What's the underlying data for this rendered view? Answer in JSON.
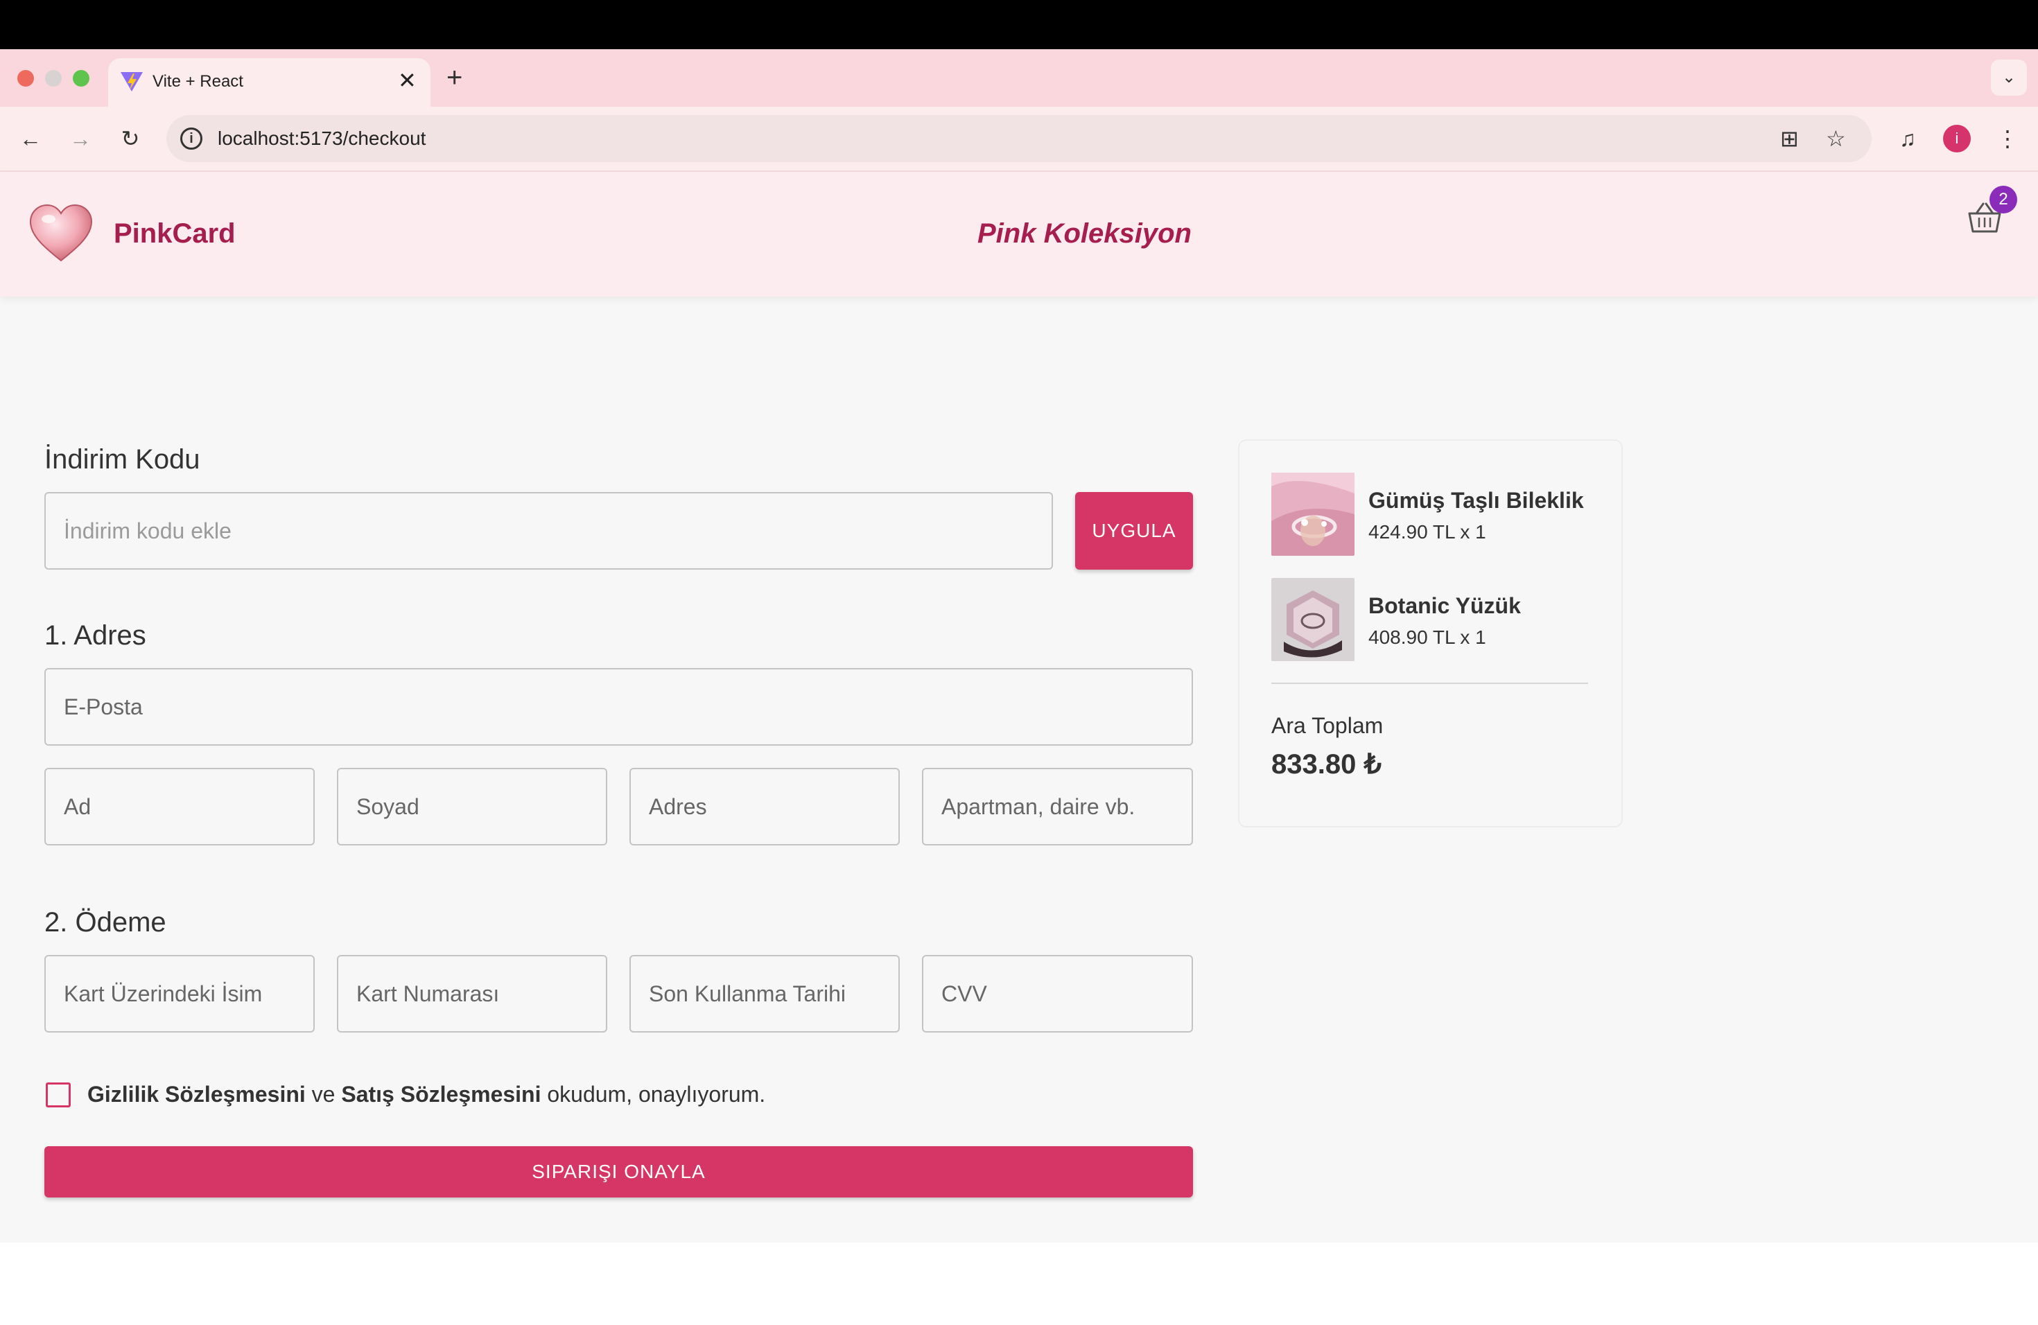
{
  "browser": {
    "tab_title": "Vite + React",
    "tab_close": "✕",
    "new_tab": "+",
    "tab_search": "⌄",
    "url": "localhost:5173/checkout",
    "profile_initial": "i"
  },
  "header": {
    "brand": "PinkCard",
    "collection": "Pink Koleksiyon",
    "cart_count": "2"
  },
  "discount": {
    "title": "İndirim Kodu",
    "placeholder": "İndirim kodu ekle",
    "apply_label": "UYGULA"
  },
  "address": {
    "title": "1. Adres",
    "email_placeholder": "E-Posta",
    "first_name_placeholder": "Ad",
    "last_name_placeholder": "Soyad",
    "address_placeholder": "Adres",
    "apartment_placeholder": "Apartman, daire vb."
  },
  "payment": {
    "title": "2. Ödeme",
    "card_name_placeholder": "Kart Üzerindeki İsim",
    "card_number_placeholder": "Kart Numarası",
    "expiry_placeholder": "Son Kullanma Tarihi",
    "cvv_placeholder": "CVV"
  },
  "consent": {
    "privacy": "Gizlilik Sözleşmesini",
    "and": " ve ",
    "sales": "Satış Sözleşmesini",
    "rest": " okudum, onaylıyorum."
  },
  "submit_label": "SIPARIŞI ONAYLA",
  "summary": {
    "items": [
      {
        "name": "Gümüş Taşlı Bileklik",
        "price": "424.90 TL x 1"
      },
      {
        "name": "Botanic Yüzük",
        "price": "408.90 TL x 1"
      }
    ],
    "subtotal_label": "Ara Toplam",
    "subtotal_value": "833.80 ₺"
  },
  "colors": {
    "accent": "#d63665",
    "brand_text": "#a51e4e",
    "header_bg": "#fcebef",
    "cart_badge": "#8a2bb9"
  }
}
